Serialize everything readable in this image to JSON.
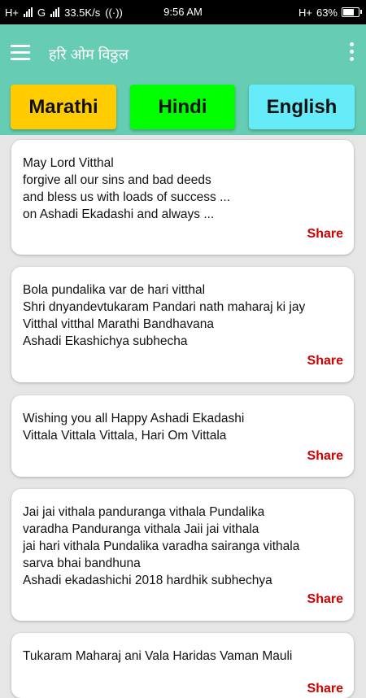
{
  "status_bar": {
    "network_left": "H+",
    "network_g": "G",
    "speed": "33.5K/s",
    "time": "9:56 AM",
    "network_right": "H+",
    "battery": "63%"
  },
  "app_bar": {
    "title": "हरि ओम विठ्ठल"
  },
  "language_buttons": [
    {
      "label": "Marathi",
      "color": "#ffcc00"
    },
    {
      "label": "Hindi",
      "color": "#00ff00"
    },
    {
      "label": "English",
      "color": "#66ecf8"
    }
  ],
  "messages": [
    {
      "text": "May Lord Vitthal\nforgive all our sins and bad deeds\nand bless us with loads of success ...\non Ashadi Ekadashi and always ...",
      "share_label": "Share"
    },
    {
      "text": "Bola pundalika var de hari vitthal\nShri dnyandevtukaram Pandari nath maharaj ki jay\nVitthal vitthal Marathi Bandhavana\nAshadi Ekashichya subhecha",
      "share_label": "Share"
    },
    {
      "text": "Wishing you all Happy Ashadi Ekadashi\nVittala Vittala Vittala, Hari Om Vittala",
      "share_label": "Share"
    },
    {
      "text": "Jai jai vithala panduranga vithala Pundalika\nvaradha Panduranga vithala Jaii jai vithala\njai hari vithala Pundalika varadha sairanga vithala\nsarva bhai bandhuna\nAshadi ekadashichi 2018 hardhik subhechya",
      "share_label": "Share"
    },
    {
      "text": "Tukaram Maharaj ani Vala Haridas Vaman Mauli",
      "share_label": "Share"
    }
  ],
  "colors": {
    "app_bar": "#66ccb3",
    "share": "#d00000",
    "background": "#e6e6e6"
  }
}
